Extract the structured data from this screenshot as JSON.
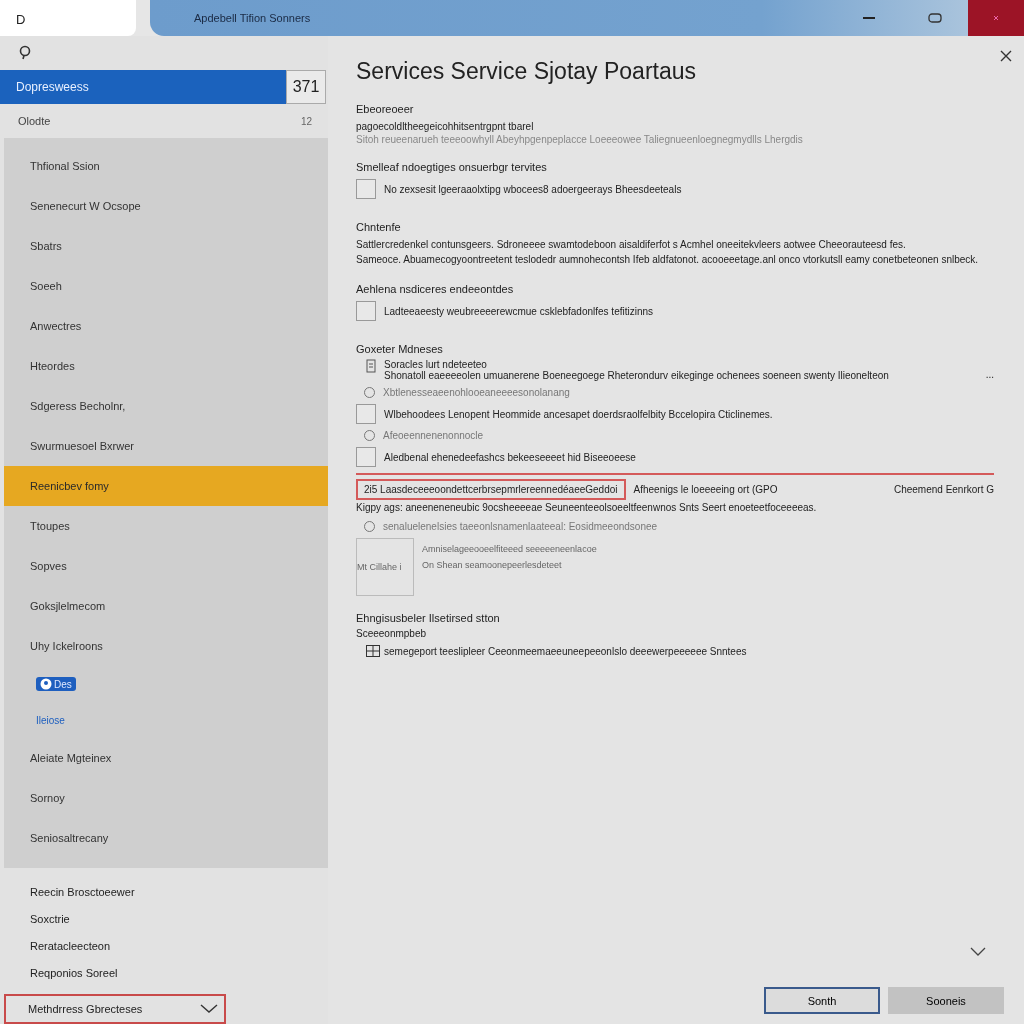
{
  "window": {
    "tab": "D",
    "title": "Apdebell Tifion Sonners"
  },
  "sidebar": {
    "header": {
      "label": "Dopresweess",
      "count": "371",
      "selected": true
    },
    "sub": {
      "label": "Olodte",
      "count": "12"
    },
    "items": [
      {
        "label": "Thfional Ssion",
        "kind": "item",
        "selected": false
      },
      {
        "label": "Senenecurt W Ocsope",
        "kind": "item",
        "selected": false
      },
      {
        "label": "Sbatrs",
        "kind": "item",
        "selected": false
      },
      {
        "label": "Soeeh",
        "kind": "item",
        "selected": false
      },
      {
        "label": "Anwectres",
        "kind": "item",
        "selected": false
      },
      {
        "label": "Hteordes",
        "kind": "item",
        "selected": false
      },
      {
        "label": "Sdgeress Becholnr,",
        "kind": "item",
        "selected": false
      },
      {
        "label": "Swurmuesoel Bxrwer",
        "kind": "item",
        "selected": false
      },
      {
        "label": "Reenicbev fomy",
        "kind": "item",
        "selected": true
      },
      {
        "label": "Ttoupes",
        "kind": "item",
        "selected": false
      },
      {
        "label": "Sopves",
        "kind": "item",
        "selected": false
      },
      {
        "label": "Goksjlelmecom",
        "kind": "item",
        "selected": false
      },
      {
        "label": "Uhy Ickelroons",
        "kind": "item",
        "selected": false
      },
      {
        "label": "Des",
        "kind": "badge",
        "selected": false
      },
      {
        "label": "Ileiose",
        "kind": "link",
        "selected": false
      },
      {
        "label": "Aleiate Mgteinex",
        "kind": "item",
        "selected": false
      },
      {
        "label": "Sornoy",
        "kind": "item",
        "selected": false
      },
      {
        "label": "Seniosaltrecany",
        "kind": "item",
        "selected": false
      }
    ],
    "footer_items": [
      "Reecin Brosctoeewer",
      "Soxctrie",
      "Reratacleecteon",
      "Reqponios Soreel"
    ],
    "dropdown": {
      "value": "Methdrress Gbrecteses"
    }
  },
  "main": {
    "heading": "Services Service Sjotay Poartaus",
    "sections": [
      {
        "title": "Ebeoreoeer",
        "rows": [
          {
            "kind": "text",
            "text": "pagoecoldltheegeicohhitsentrgpnt tbarel"
          },
          {
            "kind": "note",
            "text": "Sitoh reueenarueh teeeoowhyll Abeyhpgenpeplacce Loeeeowee Taliegnueenloegnegmydlls Lhergdis"
          }
        ]
      },
      {
        "title": "Smelleaf ndoegtiges onsuerbgr tervites",
        "rows": [
          {
            "kind": "checkbox",
            "label": "No zexsesit lgeeraaolxtipg wbocees8 adoergeerays Bheesdeeteals",
            "checked": false
          }
        ]
      },
      {
        "title": "Chntenfe",
        "rows": [
          {
            "kind": "text",
            "text": "Sattlercredenkel contunsgeers. Sdroneeee swamtodeboon aisaldiferfot s Acmhel oneeitekvleers aotwee Cheeorauteesd fes."
          },
          {
            "kind": "text",
            "text": "Sameoce. Abuamecogyoontreetent teslodedr aumnohecontsh Ifeb aldfatonot. acooeeetage.anl onco vtorkutsll eamy conetbeteonen snlbeck."
          }
        ]
      },
      {
        "title": "Aehlena nsdiceres endeeontdes",
        "rows": [
          {
            "kind": "checkbox",
            "label": "Ladteeaeesty weubreeeerewcmue csklebfadonlfes tefitizinns",
            "checked": false
          }
        ]
      },
      {
        "title": "Goxeter Mdneses",
        "rows": [
          {
            "kind": "entry",
            "title": "Soracles lurt ndeteeteo",
            "text": "Shonatoll eaeeeeolen umuanerene Boeneegoege Rheterondurv eikeginge ochenees soeneen swenty Ilieonelteon",
            "more": "..."
          },
          {
            "kind": "radio",
            "label": "Xbtlenesseaeenohlooeaneeeesonolanang",
            "selected": false
          },
          {
            "kind": "checkbox",
            "label": "Wlbehoodees Lenopent Heommide ancesapet doerdsraolfelbity Bccelopira Cticlinemes.",
            "checked": false
          },
          {
            "kind": "radio",
            "label": "Afeoeennenenonnocle",
            "selected": false
          },
          {
            "kind": "checkbox",
            "label": "Aledbenal ehenedeefashcs bekeeseeeet hid Biseeoeese",
            "checked": false
          },
          {
            "kind": "field",
            "value": "2i5 LaasdeceeeoondettcerbrsepmrlereennedéaeeGeddoi",
            "side": "Afheenigs le loeeeeing ort (GPO",
            "trailing": "Cheemend Eenrkort G"
          },
          {
            "kind": "text",
            "text": "Kigpy ags: aneeneneneubic 9ocsheeeeae Seuneenteeolsoeeltfeenwnos Snts Seert enoeteetfoceeeeas."
          },
          {
            "kind": "radio",
            "label": "senaluelenelsies taeeonlsnamenlaateeal: Eosidmeeondsonee",
            "selected": false
          },
          {
            "kind": "thumb",
            "caption": "Mt Cillahe i",
            "lines": [
              "Amniselageeooeelfiteeed seeeeeneenlacoe",
              "On Shean seamoonepeerlesdeteet"
            ]
          }
        ]
      },
      {
        "title": "Ehngisusbeler Ilsetirsed stton",
        "rows": [
          {
            "kind": "subtitle",
            "text": "Sceeeonmpbeb"
          },
          {
            "kind": "iconline",
            "text": "semegeport teeslipleer Ceeonmeemaeeuneepeeonlslo deeewerpeeeeee Snntees"
          }
        ]
      }
    ]
  },
  "buttons": [
    {
      "label": "Sonth",
      "kind": "primary"
    },
    {
      "label": "Sooneis",
      "kind": "secondary"
    }
  ]
}
